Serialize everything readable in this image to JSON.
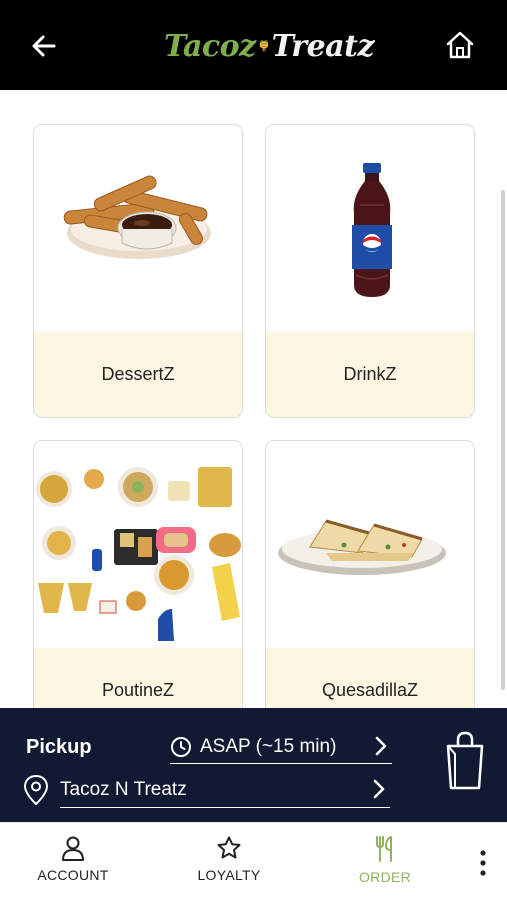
{
  "header": {
    "logo_left": "Tacoz",
    "logo_right": "Treatz",
    "back_icon": "arrow-left-icon",
    "home_icon": "home-icon"
  },
  "categories": [
    {
      "label": "DessertZ",
      "image": "churros-with-chocolate"
    },
    {
      "label": "DrinkZ",
      "image": "pepsi-bottle"
    },
    {
      "label": "PoutineZ",
      "image": "assorted-food-spread"
    },
    {
      "label": "QuesadillaZ",
      "image": "quesadilla-plate"
    }
  ],
  "pickup": {
    "label": "Pickup",
    "time": "ASAP (~15 min)",
    "location": "Tacoz N Treatz"
  },
  "nav": {
    "account": "ACCOUNT",
    "loyalty": "LOYALTY",
    "order": "ORDER",
    "active": "order"
  },
  "colors": {
    "header_bg": "#000000",
    "logo_green": "#7fae4a",
    "caption_bg": "#fcf6e3",
    "pickup_bg": "#121a33",
    "active_nav": "#8fb25e"
  }
}
